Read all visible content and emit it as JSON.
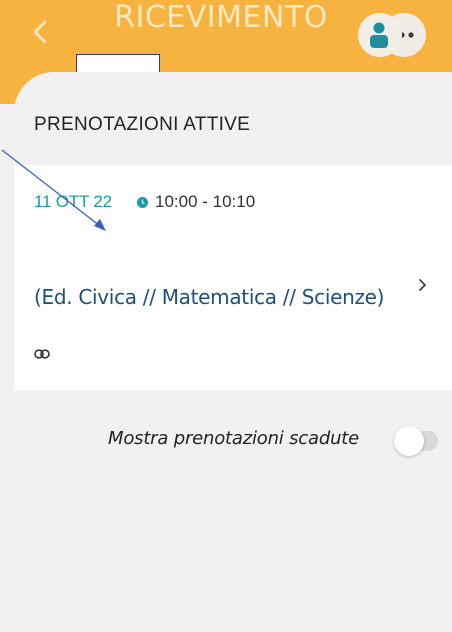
{
  "header": {
    "title": "RICEVIMENTO",
    "back_icon": "chevron-left-icon",
    "avatar_icon": "user-icon",
    "more_icon": "more-horizontal-icon",
    "accent_color": "#f7b33f"
  },
  "section": {
    "title": "PRENOTAZIONI ATTIVE"
  },
  "booking": {
    "date": "11 OTT 22",
    "time": "10:00 - 10:10",
    "subjects": "(Ed. Civica // Matematica // Scienze)",
    "clock_icon": "clock-icon",
    "chevron_icon": "chevron-right-icon",
    "link_icon": "link-icon",
    "date_color": "#1b9aaa"
  },
  "filter": {
    "label": "Mostra prenotazioni scadute",
    "enabled": false
  }
}
